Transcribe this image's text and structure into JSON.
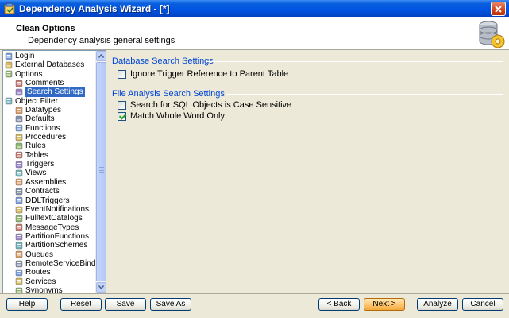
{
  "window": {
    "title": "Dependency Analysis Wizard - [*]"
  },
  "header": {
    "title": "Clean Options",
    "subtitle": "Dependency analysis general settings"
  },
  "tree": {
    "items": [
      {
        "label": "Login",
        "level": 0,
        "icon": "login-icon"
      },
      {
        "label": "External Databases",
        "level": 0,
        "icon": "database-icon"
      },
      {
        "label": "Options",
        "level": 0,
        "icon": "options-icon"
      },
      {
        "label": "Comments",
        "level": 1,
        "icon": "comments-icon"
      },
      {
        "label": "Search Settings",
        "level": 1,
        "icon": "binoculars-icon",
        "selected": true
      },
      {
        "label": "Object Filter",
        "level": 0,
        "icon": "filter-icon"
      },
      {
        "label": "Datatypes",
        "level": 1,
        "icon": "datatypes-icon"
      },
      {
        "label": "Defaults",
        "level": 1,
        "icon": "defaults-icon"
      },
      {
        "label": "Functions",
        "level": 1,
        "icon": "functions-icon"
      },
      {
        "label": "Procedures",
        "level": 1,
        "icon": "procedures-icon"
      },
      {
        "label": "Rules",
        "level": 1,
        "icon": "rules-icon"
      },
      {
        "label": "Tables",
        "level": 1,
        "icon": "tables-icon"
      },
      {
        "label": "Triggers",
        "level": 1,
        "icon": "triggers-icon"
      },
      {
        "label": "Views",
        "level": 1,
        "icon": "views-icon"
      },
      {
        "label": "Assemblies",
        "level": 1,
        "icon": "assemblies-icon"
      },
      {
        "label": "Contracts",
        "level": 1,
        "icon": "contracts-icon"
      },
      {
        "label": "DDLTriggers",
        "level": 1,
        "icon": "ddltriggers-icon"
      },
      {
        "label": "EventNotifications",
        "level": 1,
        "icon": "eventnotifications-icon"
      },
      {
        "label": "FulltextCatalogs",
        "level": 1,
        "icon": "fulltextcatalogs-icon"
      },
      {
        "label": "MessageTypes",
        "level": 1,
        "icon": "messagetypes-icon"
      },
      {
        "label": "PartitionFunctions",
        "level": 1,
        "icon": "partitionfunctions-icon"
      },
      {
        "label": "PartitionSchemes",
        "level": 1,
        "icon": "partitionschemes-icon"
      },
      {
        "label": "Queues",
        "level": 1,
        "icon": "queues-icon"
      },
      {
        "label": "RemoteServiceBindings",
        "level": 1,
        "icon": "remoteservicebindings-icon"
      },
      {
        "label": "Routes",
        "level": 1,
        "icon": "routes-icon"
      },
      {
        "label": "Services",
        "level": 1,
        "icon": "services-icon"
      },
      {
        "label": "Synonyms",
        "level": 1,
        "icon": "synonyms-icon"
      }
    ]
  },
  "content": {
    "db_group": {
      "title": "Database Search Settings",
      "options": [
        {
          "label": "Ignore Trigger Reference to Parent Table",
          "checked": false
        }
      ]
    },
    "file_group": {
      "title": "File Analysis Search Settings",
      "options": [
        {
          "label": "Search for SQL Objects is Case Sensitive",
          "checked": false
        },
        {
          "label": "Match Whole Word Only",
          "checked": true
        }
      ]
    }
  },
  "buttons": {
    "help": "Help",
    "reset": "Reset",
    "save": "Save",
    "save_as": "Save As",
    "back": "< Back",
    "next": "Next >",
    "analyze": "Analyze",
    "cancel": "Cancel"
  },
  "colors": {
    "selection": "#316ac5",
    "group_title": "#0046d5",
    "titlebar": "#0054e3"
  }
}
